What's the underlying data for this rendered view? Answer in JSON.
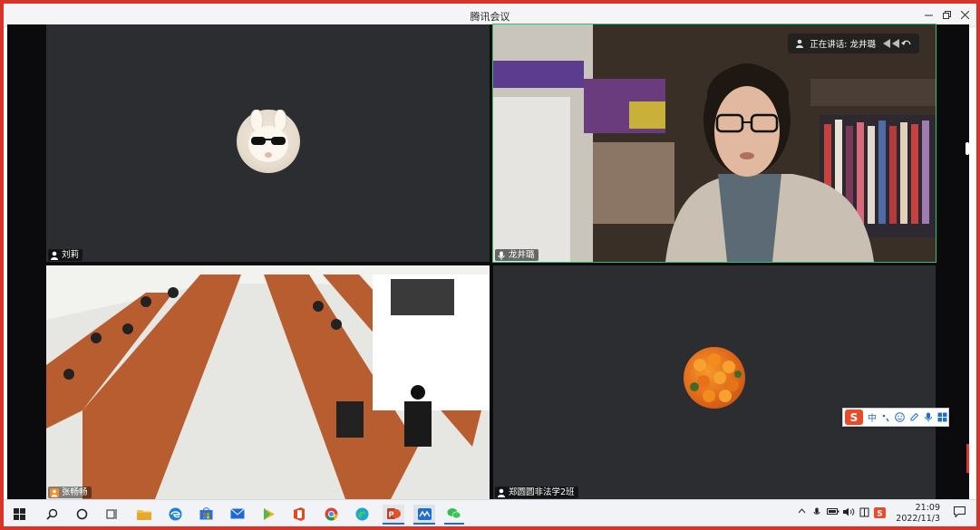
{
  "window": {
    "title": "腾讯会议",
    "controls": [
      "minimize-icon",
      "restore-icon",
      "close-icon"
    ]
  },
  "grid": {
    "tiles": [
      {
        "participant": "刘莉",
        "video": "avatar",
        "mic_icon": "person-icon"
      },
      {
        "participant": "龙井璐",
        "video": "camera",
        "mic_icon": "microphone-icon"
      },
      {
        "participant": "张畅畅",
        "video": "camera",
        "mic_icon": "person-icon"
      },
      {
        "participant": "郑圆圆非法学2班",
        "video": "avatar",
        "mic_icon": "person-icon"
      }
    ],
    "speaking_indicator": {
      "label": "正在讲话: 龙井璐"
    }
  },
  "ime_toolbar": {
    "mode": "中",
    "items": [
      "sogou-logo-icon",
      "punctuation-icon",
      "emoji-icon",
      "pen-icon",
      "voice-icon",
      "toolbox-icon"
    ]
  },
  "taskbar": {
    "apps": [
      "start-icon",
      "search-icon",
      "cortana-icon",
      "task-view-icon",
      "file-explorer-icon",
      "edge-legacy-icon",
      "store-icon",
      "mail-icon",
      "media-player-icon",
      "office-icon",
      "chrome-icon",
      "edge-icon",
      "powerpoint-icon",
      "tencent-meeting-icon",
      "wechat-icon"
    ],
    "time": "21:09",
    "date": "2022/11/3"
  },
  "colors": {
    "border": "#d8352a",
    "tile_bg": "#2b2d30",
    "active_speaker": "#2fbf71"
  }
}
